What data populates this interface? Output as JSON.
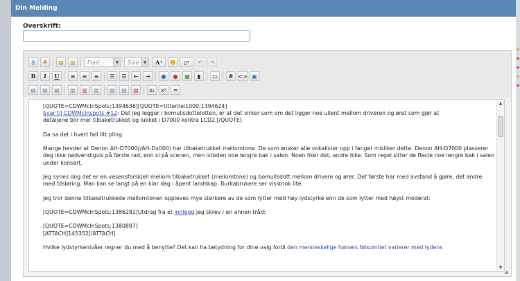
{
  "panel": {
    "title": "Din Melding"
  },
  "subject": {
    "label": "Overskrift:",
    "value": ""
  },
  "toolbar": {
    "font_placeholder": "Font",
    "size_placeholder": "Size",
    "font_color_label": "A",
    "bold": "B",
    "italic": "I",
    "underline": "U",
    "hash": "#",
    "code": "<>",
    "subscript": "x₂",
    "superscript": "x²"
  },
  "editor": {
    "line1": "[QUOTE=CDWMcInSpots;1394636][QUOTE=tittentei1000;1394624]",
    "link1": "Svar til CDWMcInspots #12",
    "line2_rest": ": Det jeg legger i bomullsdottelotten, er at det virker som om det ligger noe ullent mellom driveren og øret som gjør at",
    "line3": "detaljene blir mer tilbaketrukket og lukket i D7000 kontra LCD2.[/QUOTE]",
    "para2": "Da sa det i hvert fall litt pling.",
    "para3": "Mange hevder at Denon AH-D7000(/AH-Dx000) har tilbaketrukket mellomtone. De som ønsker alle vokalister opp i fanget misliker dette. Denon AH-D7000 plasserer deg ikke nødvendigvis på første rad, enn si på scenen, men isteden noe lengre bak i salen. Noen liker det, andre ikke. Som regel sitter de fleste noe lengre bak i salen under konsert.",
    "para4": "Jeg synes dog det er en vesensforskjell mellom tilbaketrukket (mellomtone) og bomullsdott mellom drivere og ører. Det første har med avstand å gjøre, det andre med tilsløring. Man kan se langt på en klar dag i åpent landskap. Burkabrukere ser visstnok lite.",
    "para5": "Jeg tror denne tilbaketrukkede mellomtonen oppleves mye sterkere av de som lytter med høy lydstyrke enn de som lytter med høyst moderat:",
    "para6_pre": "[QUOTE=CDWMcInSpots;1386282]Utdrag fra et ",
    "para6_link": "innlegg",
    "para6_post": " jeg skrev i en annen tråd:",
    "para7a": "[QUOTE=CDWMcInSpots;1380887]",
    "para7b": "[ATTACH]145352[/ATTACH]",
    "para8_pre": "Hvilke lydstyrkenivåer regner du med å benytte? Det kan ha betydning for dine valg fordi ",
    "para8_link": "den menneskelige hørsels følsomhet varierer med lydens"
  },
  "colors": {
    "header_bg": "#5b86b4",
    "link": "#2c3ea8",
    "mark_orange": "#e8a23a",
    "mark_red": "#d9534f"
  }
}
